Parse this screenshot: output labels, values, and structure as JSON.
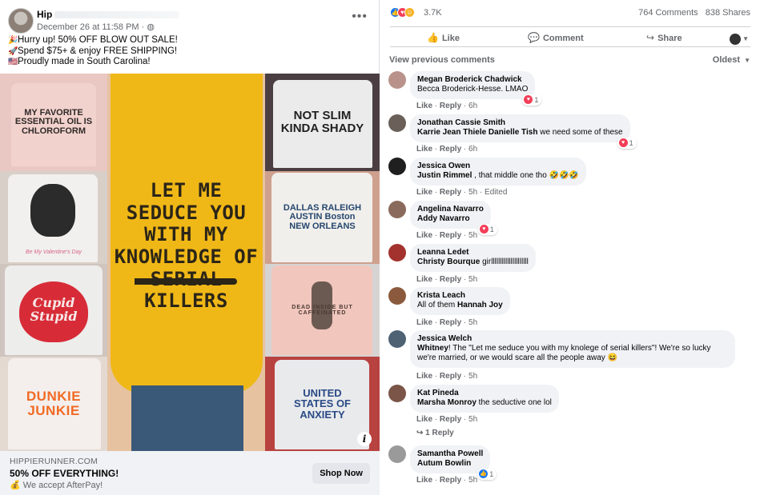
{
  "post": {
    "page_name": "Hip",
    "timestamp": "December 26 at 11:58 PM · ",
    "globe_icon": "globe-icon",
    "text_lines": [
      {
        "emoji": "🎉",
        "text": "Hurry up! 50% OFF BLOW OUT SALE!"
      },
      {
        "emoji": "🚀",
        "text": "Spend $75+ & enjoy FREE SHIPPING!"
      },
      {
        "emoji": "🇺🇸",
        "text": "Proudly made in South Carolina!"
      }
    ],
    "image": {
      "center": "LET ME SEDUCE YOU WITH MY KNOWLEDGE OF SERIAL KILLERS",
      "tiles": [
        "MY FAVORITE ESSENTIAL OIL IS CHLOROFORM",
        "NOT SLIM KINDA SHADY",
        "Be My Valentine's Day",
        "DALLAS RALEIGH AUSTIN Boston NEW ORLEANS",
        "Cupid Stupid",
        "DEAD INSIDE BUT CAFFEINATED",
        "DUNKIE JUNKIE",
        "UNITED STATES OF ANXIETY"
      ]
    },
    "cta": {
      "domain": "HIPPIERUNNER.COM",
      "headline": "50% OFF EVERYTHING!",
      "description": "We accept AfterPay!",
      "description_emoji": "💰",
      "button": "Shop Now"
    }
  },
  "stats": {
    "reaction_count": "3.7K",
    "comments": "764 Comments",
    "shares": "838 Shares"
  },
  "actions": {
    "like": "Like",
    "comment": "Comment",
    "share": "Share"
  },
  "comments_header": {
    "view_previous": "View previous comments",
    "sort": "Oldest"
  },
  "comments": [
    {
      "author": "Megan Broderick Chadwick",
      "tag": "Becca Broderick-Hesse.",
      "text": " LMAO",
      "like": "Like",
      "reply": "Reply",
      "time": "6h",
      "reaction": "love",
      "reaction_count": "1",
      "avatar_color": "#b9938a"
    },
    {
      "author": "Jonathan Cassie Smith",
      "tag": "Karrie Jean Thiele Danielle Tish",
      "text": " we need some of these",
      "like": "Like",
      "reply": "Reply",
      "time": "6h",
      "reaction": "love",
      "reaction_count": "1",
      "avatar_color": "#6b5f5a"
    },
    {
      "author": "Jessica Owen",
      "tag": "Justin Rimmel",
      "text": " , that middle one tho 🤣🤣🤣",
      "like": "Like",
      "reply": "Reply",
      "time": "5h",
      "edited": "Edited",
      "avatar_color": "#1f1f1f"
    },
    {
      "author": "Angelina Navarro",
      "tag": "Addy Navarro",
      "text": "",
      "like": "Like",
      "reply": "Reply",
      "time": "5h",
      "reaction": "love",
      "reaction_count": "1",
      "avatar_color": "#8a6a5c"
    },
    {
      "author": "Leanna Ledet",
      "tag": "Christy Bourque",
      "text": " girlllllllllllllllllllll",
      "like": "Like",
      "reply": "Reply",
      "time": "5h",
      "avatar_color": "#a3322e"
    },
    {
      "author": "Krista Leach",
      "tag": "",
      "text": "All of them ",
      "tag2": "Hannah Joy",
      "like": "Like",
      "reply": "Reply",
      "time": "5h",
      "avatar_color": "#8b5a3c"
    },
    {
      "author": "Jessica Welch",
      "tag": "Whitney",
      "text": "! The \"Let me seduce you with my knolege of serial killers\"! We're so lucky we're married, or we would scare all the people away 😆",
      "like": "Like",
      "reply": "Reply",
      "time": "5h",
      "avatar_color": "#4e6274"
    },
    {
      "author": "Kat Pineda",
      "tag": "Marsha Monroy",
      "text": " the seductive one lol",
      "like": "Like",
      "reply": "Reply",
      "time": "5h",
      "replies": "1 Reply",
      "avatar_color": "#7a5548"
    },
    {
      "author": "Samantha Powell",
      "tag": "Autum Bowlin",
      "text": "",
      "like": "Like",
      "reply": "Reply",
      "time": "5h",
      "reaction": "like",
      "reaction_count": "1",
      "avatar_color": "#9a9a9a"
    }
  ],
  "colors": {
    "like_blue": "#1877f2",
    "love_red": "#f33e58",
    "haha_yellow": "#f7b125",
    "bubble_gray": "#f0f2f5",
    "meta_gray": "#65676b"
  }
}
